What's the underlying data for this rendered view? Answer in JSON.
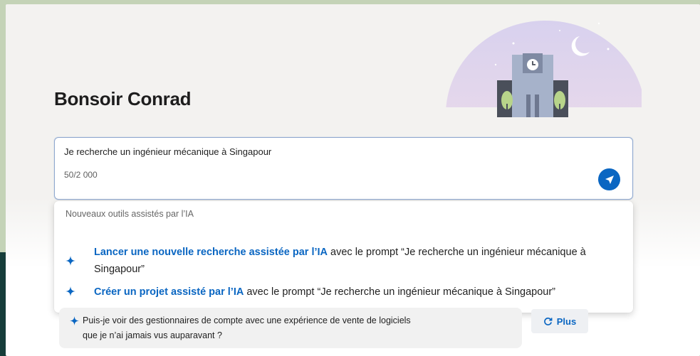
{
  "greeting": "Bonsoir Conrad",
  "prompt": {
    "value": "Je recherche un ingénieur mécanique à Singapour",
    "char_count": "50/2 000"
  },
  "dropdown": {
    "header": "Nouveaux outils assistés par l’IA",
    "options": [
      {
        "link": "Lancer une nouvelle recherche assistée par l’IA",
        "text": " avec le prompt “Je recherche un ingénieur mécanique à Singapour”"
      },
      {
        "link": "Créer un projet assisté par l’IA",
        "text": " avec le prompt “Je recherche un ingénieur mécanique à Singapour”"
      }
    ]
  },
  "suggestion": {
    "line1": "Puis-je voir des gestionnaires de compte avec une expérience de vente de logiciels",
    "line2": "que je n’ai jamais vus auparavant ?"
  },
  "more_label": "Plus",
  "icons": {
    "send": "send-icon",
    "spark": "spark-icon",
    "refresh": "refresh-icon"
  },
  "colors": {
    "accent": "#0a66c2",
    "background": "#c4d3b7"
  }
}
